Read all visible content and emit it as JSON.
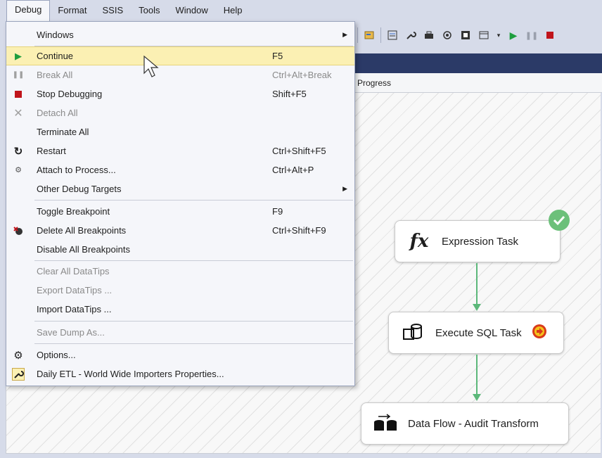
{
  "menubar": {
    "items": [
      "Debug",
      "Format",
      "SSIS",
      "Tools",
      "Window",
      "Help"
    ]
  },
  "tab": {
    "label": "Progress"
  },
  "debug_menu": {
    "items": [
      {
        "label": "Windows",
        "shortcut": "",
        "submenu": true,
        "disabled": false,
        "icon": ""
      },
      {
        "label": "Continue",
        "shortcut": "F5",
        "submenu": false,
        "disabled": false,
        "icon": "play-icon",
        "highlighted": true
      },
      {
        "label": "Break All",
        "shortcut": "Ctrl+Alt+Break",
        "submenu": false,
        "disabled": true,
        "icon": "pause-icon"
      },
      {
        "label": "Stop Debugging",
        "shortcut": "Shift+F5",
        "submenu": false,
        "disabled": false,
        "icon": "stop-icon"
      },
      {
        "label": "Detach All",
        "shortcut": "",
        "submenu": false,
        "disabled": true,
        "icon": "x-icon"
      },
      {
        "label": "Terminate All",
        "shortcut": "",
        "submenu": false,
        "disabled": false,
        "icon": ""
      },
      {
        "label": "Restart",
        "shortcut": "Ctrl+Shift+F5",
        "submenu": false,
        "disabled": false,
        "icon": "restart-icon"
      },
      {
        "label": "Attach to Process...",
        "shortcut": "Ctrl+Alt+P",
        "submenu": false,
        "disabled": false,
        "icon": "gears-icon"
      },
      {
        "label": "Other Debug Targets",
        "shortcut": "",
        "submenu": true,
        "disabled": false,
        "icon": ""
      },
      {
        "label": "Toggle Breakpoint",
        "shortcut": "F9",
        "submenu": false,
        "disabled": false,
        "icon": ""
      },
      {
        "label": "Delete All Breakpoints",
        "shortcut": "Ctrl+Shift+F9",
        "submenu": false,
        "disabled": false,
        "icon": "delete-breakpoints-icon"
      },
      {
        "label": "Disable All Breakpoints",
        "shortcut": "",
        "submenu": false,
        "disabled": false,
        "icon": ""
      },
      {
        "label": "Clear All DataTips",
        "shortcut": "",
        "submenu": false,
        "disabled": true,
        "icon": ""
      },
      {
        "label": "Export DataTips ...",
        "shortcut": "",
        "submenu": false,
        "disabled": true,
        "icon": ""
      },
      {
        "label": "Import DataTips ...",
        "shortcut": "",
        "submenu": false,
        "disabled": false,
        "icon": ""
      },
      {
        "label": "Save Dump As...",
        "shortcut": "",
        "submenu": false,
        "disabled": true,
        "icon": ""
      },
      {
        "label": "Options...",
        "shortcut": "",
        "submenu": false,
        "disabled": false,
        "icon": "gear-icon"
      },
      {
        "label": "Daily ETL - World Wide Importers Properties...",
        "shortcut": "",
        "submenu": false,
        "disabled": false,
        "icon": "wrench-icon"
      }
    ]
  },
  "tasks": [
    {
      "label": "Expression Task",
      "icon": "fx-icon",
      "status": "success-check-icon"
    },
    {
      "label": "Execute SQL Task",
      "icon": "sql-task-icon",
      "status": "executing-arrow-icon"
    },
    {
      "label": "Data Flow - Audit Transform",
      "icon": "data-flow-icon",
      "status": ""
    }
  ],
  "colors": {
    "menubar_bg": "#d6dbe9",
    "menu_bg": "#f5f6fa",
    "highlight": "#fbf0b3",
    "dark_bar": "#2b3a67",
    "success_green": "#5cb87a",
    "play_green": "#1e9e3e",
    "stop_red": "#c0141b"
  }
}
